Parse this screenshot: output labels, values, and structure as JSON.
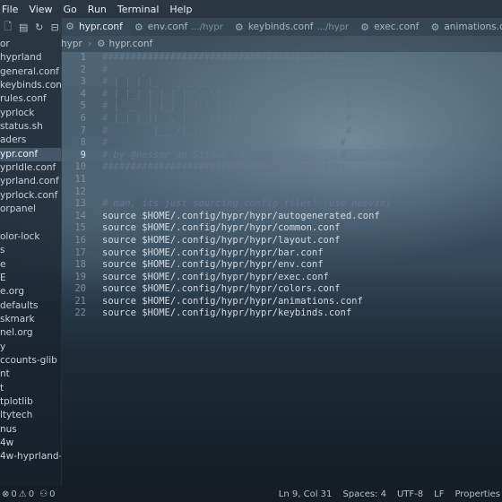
{
  "menubar": {
    "items": [
      "File",
      "View",
      "Go",
      "Run",
      "Terminal",
      "Help"
    ]
  },
  "tabs": [
    {
      "label": "hypr.conf",
      "hint": "",
      "active": true
    },
    {
      "label": "env.conf",
      "hint": ".../hypr",
      "active": false
    },
    {
      "label": "keybinds.conf",
      "hint": ".../hypr",
      "active": false
    },
    {
      "label": "exec.conf",
      "hint": "",
      "active": false
    },
    {
      "label": "animations.conf",
      "hint": "",
      "active": false
    }
  ],
  "breadcrumbs": {
    "folder": "hypr",
    "file": "hypr.conf"
  },
  "sidebar": {
    "items": [
      "or",
      "hyprland",
      "general.conf",
      "keybinds.conf",
      "rules.conf",
      "yprlock",
      "status.sh",
      "aders",
      "ypr.conf",
      "yprIdle.conf",
      "yprland.conf",
      "yprlock.conf",
      "orpanel",
      "",
      "olor-lock",
      "s",
      "e",
      "E",
      "e.org",
      "defaults",
      "skmark",
      "nel.org",
      "y",
      "ccounts-glib",
      "nt",
      "t",
      "tplotlib",
      "ltytech",
      "nus",
      "4w",
      "4w-hyprland-s..."
    ],
    "selected_index": 8
  },
  "editor": {
    "current_line": 9,
    "lines": [
      "###########################################",
      "#  _   _                                  #",
      "# | | | |_   _ _ __  _ __                  #",
      "# | |_| | | | | '_ \\| '__|                 #",
      "# |  _  | |_| | |_) | |                    #",
      "# |_| |_|\\__, | .__/|_|                    #",
      "#        |___/|_|                          #",
      "#                                         #",
      "# by @nessmr on GitHub (2025)             #",
      "###########################################",
      "",
      "",
      "# man, its just sourcing config files! (use neovim)",
      "source $HOME/.config/hypr/hypr/autogenerated.conf",
      "source $HOME/.config/hypr/hypr/common.conf",
      "source $HOME/.config/hypr/hypr/layout.conf",
      "source $HOME/.config/hypr/hypr/bar.conf",
      "source $HOME/.config/hypr/hypr/env.conf",
      "source $HOME/.config/hypr/hypr/exec.conf",
      "source $HOME/.config/hypr/hypr/colors.conf",
      "source $HOME/.config/hypr/hypr/animations.conf",
      "source $HOME/.config/hypr/hypr/keybinds.conf"
    ]
  },
  "statusbar": {
    "errors": "0",
    "warnings": "0",
    "ports": "0",
    "position": "Ln 9, Col 31",
    "spaces": "Spaces: 4",
    "encoding": "UTF-8",
    "eol": "LF",
    "language": "Properties"
  }
}
